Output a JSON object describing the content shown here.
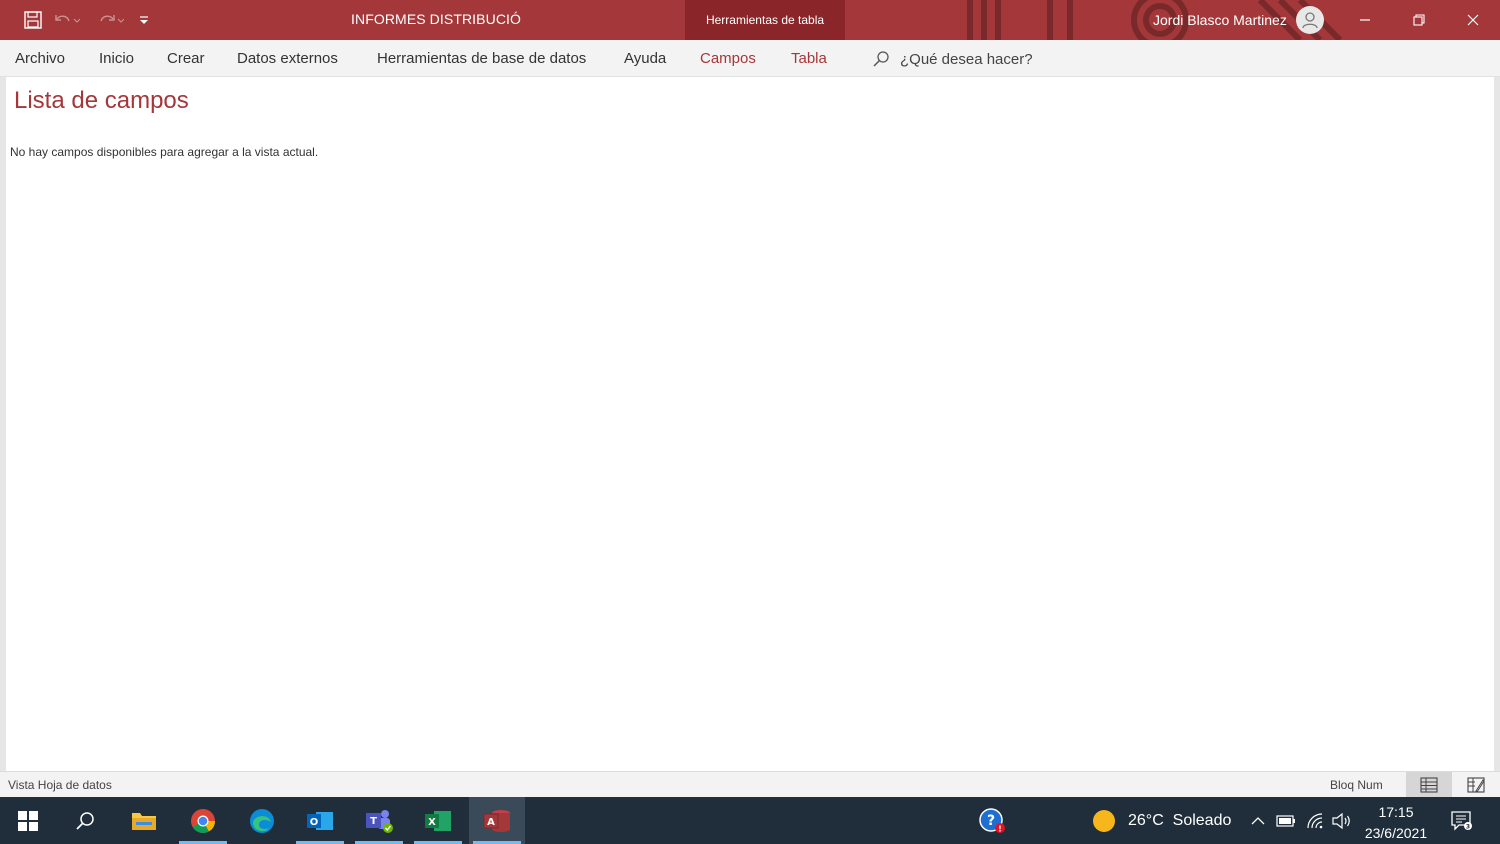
{
  "titlebar": {
    "document_title": "INFORMES DISTRIBUCIÓ",
    "context_tab_label": "Herramientas de tabla",
    "user_name": "Jordi Blasco Martinez",
    "accent_color": "#a4373a"
  },
  "quick_access": {
    "icons": [
      "save-icon",
      "undo-icon",
      "redo-icon",
      "customize-qat-icon"
    ]
  },
  "ribbon": {
    "tabs": [
      {
        "label": "Archivo",
        "contextual": false
      },
      {
        "label": "Inicio",
        "contextual": false
      },
      {
        "label": "Crear",
        "contextual": false
      },
      {
        "label": "Datos externos",
        "contextual": false
      },
      {
        "label": "Herramientas de base de datos",
        "contextual": false
      },
      {
        "label": "Ayuda",
        "contextual": false
      },
      {
        "label": "Campos",
        "contextual": true
      },
      {
        "label": "Tabla",
        "contextual": true
      }
    ],
    "tell_me_placeholder": "¿Qué desea hacer?"
  },
  "field_list": {
    "title": "Lista de campos",
    "message": "No hay campos disponibles para agregar a la vista actual."
  },
  "statusbar": {
    "view_label": "Vista Hoja de datos",
    "numlock_label": "Bloq Num",
    "view_icons": [
      "datasheet-view-icon",
      "design-view-icon"
    ]
  },
  "taskbar": {
    "apps": [
      "windows-start",
      "search",
      "file-explorer",
      "chrome",
      "edge",
      "outlook",
      "teams",
      "excel",
      "access"
    ],
    "weather_text": "26°C  Soleado",
    "time": "17:15",
    "date": "23/6/2021"
  }
}
